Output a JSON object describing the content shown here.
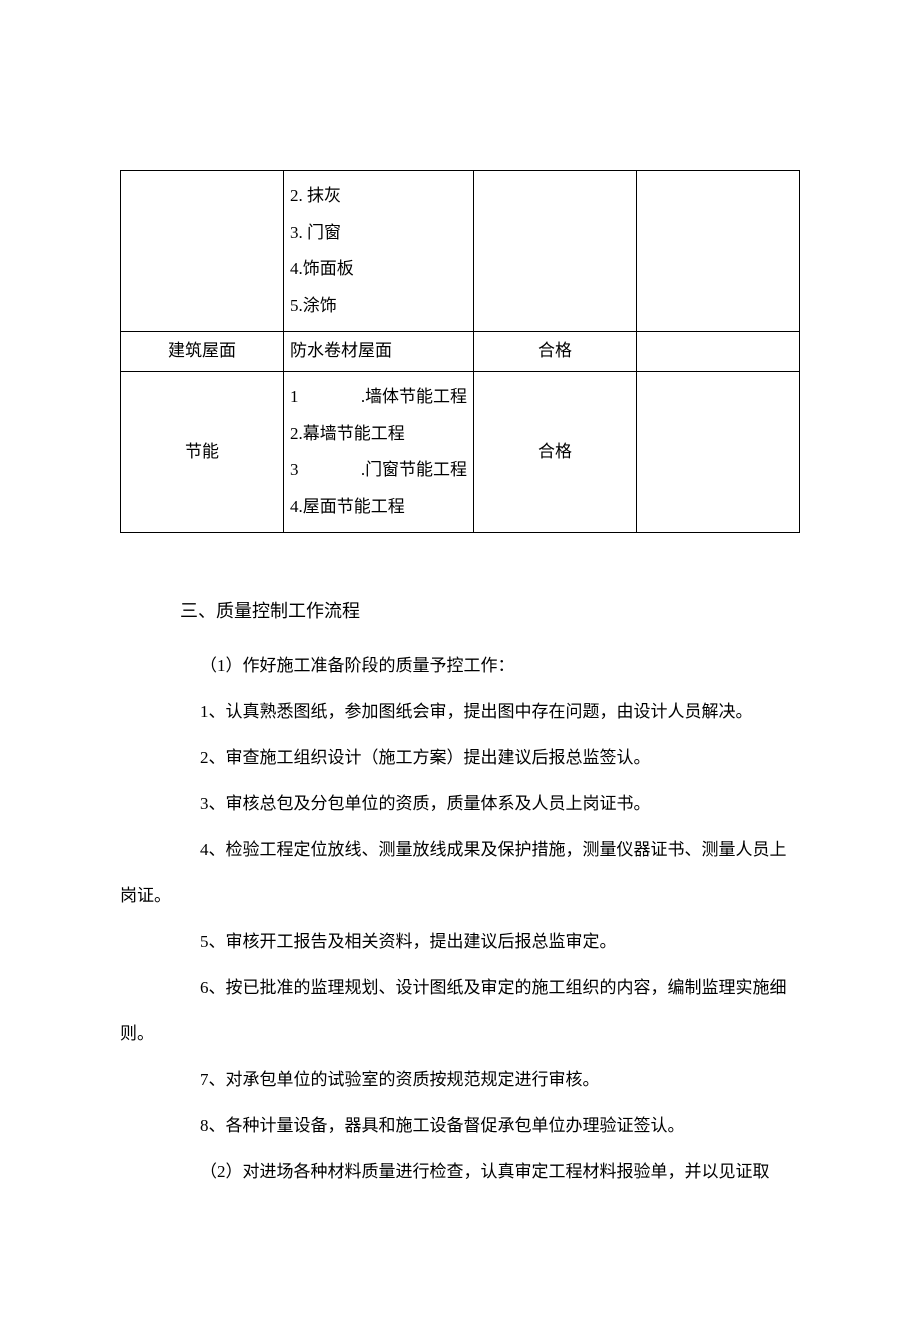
{
  "table": {
    "row1": {
      "items": [
        "2. 抹灰",
        "3. 门窗",
        "4.饰面板",
        "5.涂饰"
      ]
    },
    "row2": {
      "col1": "建筑屋面",
      "col2": "防水卷材屋面",
      "col3": "合格",
      "col4": ""
    },
    "row3": {
      "col1": "节能",
      "items": [
        {
          "num": "1",
          "text": ".墙体节能工程",
          "justify": true
        },
        {
          "num": "",
          "text": "2.幕墙节能工程",
          "justify": false
        },
        {
          "num": "3",
          "text": ".门窗节能工程",
          "justify": true
        },
        {
          "num": "",
          "text": "4.屋面节能工程",
          "justify": false
        }
      ],
      "col3": "合格",
      "col4": ""
    }
  },
  "section_title": "三、质量控制工作流程",
  "sub1": "（1）作好施工准备阶段的质量予控工作：",
  "p1": "1、认真熟悉图纸，参加图纸会审，提出图中存在问题，由设计人员解决。",
  "p2": "2、审查施工组织设计（施工方案）提出建议后报总监签认。",
  "p3": "3、审核总包及分包单位的资质，质量体系及人员上岗证书。",
  "p4a": "4、检验工程定位放线、测量放线成果及保护措施，测量仪器证书、测量人员上",
  "p4b": "岗证。",
  "p5": "5、审核开工报告及相关资料，提出建议后报总监审定。",
  "p6a": "6、按已批准的监理规划、设计图纸及审定的施工组织的内容，编制监理实施细",
  "p6b": "则。",
  "p7": "7、对承包单位的试验室的资质按规范规定进行审核。",
  "p8": "8、各种计量设备，器具和施工设备督促承包单位办理验证签认。",
  "sub2": "（2）对进场各种材料质量进行检查，认真审定工程材料报验单，并以见证取"
}
